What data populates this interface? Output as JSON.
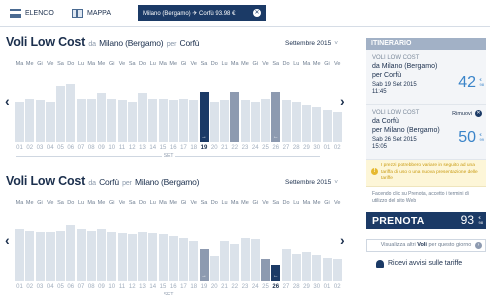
{
  "tabs": {
    "list": "ELENCO",
    "map": "MAPPA"
  },
  "filter_chip": {
    "label": "Milano (Bergamo) ✈ Corfù 93.98 €"
  },
  "sections": [
    {
      "title_big": "Voli Low Cost",
      "from_word": "da",
      "from_city": "Milano (Bergamo)",
      "to_word": "per",
      "to_city": "Corfù",
      "month_label": "Settembre 2015",
      "set_label": "SET"
    },
    {
      "title_big": "Voli Low Cost",
      "from_word": "da",
      "from_city": "Corfù",
      "to_word": "per",
      "to_city": "Milano (Bergamo)",
      "month_label": "Settembre 2015",
      "set_label": "SET"
    }
  ],
  "weekdays": [
    "Ma",
    "Me",
    "Gi",
    "Ve",
    "Sa",
    "Do",
    "Lu",
    "Ma",
    "Me",
    "Gi",
    "Ve",
    "Sa",
    "Do",
    "Lu",
    "Ma",
    "Me",
    "Gi",
    "Ve",
    "Sa",
    "Do",
    "Lu",
    "Ma",
    "Me",
    "Gi",
    "Ve",
    "Sa",
    "Do",
    "Lu",
    "Ma",
    "Me",
    "Gi",
    "Ve"
  ],
  "days": [
    "01",
    "02",
    "03",
    "04",
    "05",
    "06",
    "07",
    "08",
    "09",
    "10",
    "11",
    "12",
    "13",
    "14",
    "15",
    "16",
    "17",
    "18",
    "19",
    "20",
    "21",
    "22",
    "23",
    "24",
    "25",
    "26",
    "27",
    "28",
    "29",
    "30",
    "01",
    "02"
  ],
  "outbound_selected_day": "19",
  "return_selected_day": "26",
  "outbound_bar_levels": [
    0.55,
    0.6,
    0.58,
    0.55,
    0.78,
    0.8,
    0.6,
    0.6,
    0.68,
    0.6,
    0.58,
    0.55,
    0.68,
    0.6,
    0.6,
    0.58,
    0.6,
    0.58,
    0.7,
    0.55,
    0.58,
    0.7,
    0.58,
    0.55,
    0.6,
    0.7,
    0.58,
    0.55,
    0.52,
    0.48,
    0.45,
    0.42
  ],
  "return_bar_levels": [
    0.72,
    0.7,
    0.68,
    0.68,
    0.7,
    0.78,
    0.72,
    0.7,
    0.72,
    0.68,
    0.66,
    0.65,
    0.68,
    0.66,
    0.65,
    0.62,
    0.6,
    0.55,
    0.45,
    0.35,
    0.55,
    0.52,
    0.6,
    0.58,
    0.3,
    0.22,
    0.45,
    0.38,
    0.4,
    0.36,
    0.32,
    0.3
  ],
  "itinerary": {
    "header": "ITINERARIO",
    "outbound": {
      "label": "VOLI LOW COST",
      "from_line": "da Milano (Bergamo)",
      "to_line": "per Corfù",
      "date_line": "Sab 19 Set 2015",
      "time_line": "11:45",
      "price": "42",
      "price_sup": "€",
      "price_sub": "98"
    },
    "return": {
      "label": "VOLI LOW COST",
      "remove_label": "Rimuovi",
      "from_line": "da Corfù",
      "to_line": "per Milano (Bergamo)",
      "date_line": "Sab 26 Set 2015",
      "time_line": "15:05",
      "price": "50",
      "price_sup": "€",
      "price_sub": "99"
    },
    "notice": "I prezzi potrebbero variare in seguito ad una tariffa di uso o una nuova presentazione delle tariffe",
    "terms": "Facendo clic su Prenota, accetto i termini di utilizzo del sito Web",
    "book": {
      "label": "PRENOTA",
      "price": "93",
      "price_sup": "€",
      "price_sub": "98"
    },
    "view_other": {
      "prefix": "Visualizza altri",
      "bold": "Voli",
      "suffix": "per questo giorno"
    },
    "alerts": "Ricevi avvisi sulle tariffe"
  },
  "colors": {
    "navy": "#1b3a66",
    "bar_light": "#dbe2ea",
    "bar_mid": "#8d9ab0",
    "price_blue": "#3a84c9",
    "notice_bg": "#fdf6d8"
  }
}
